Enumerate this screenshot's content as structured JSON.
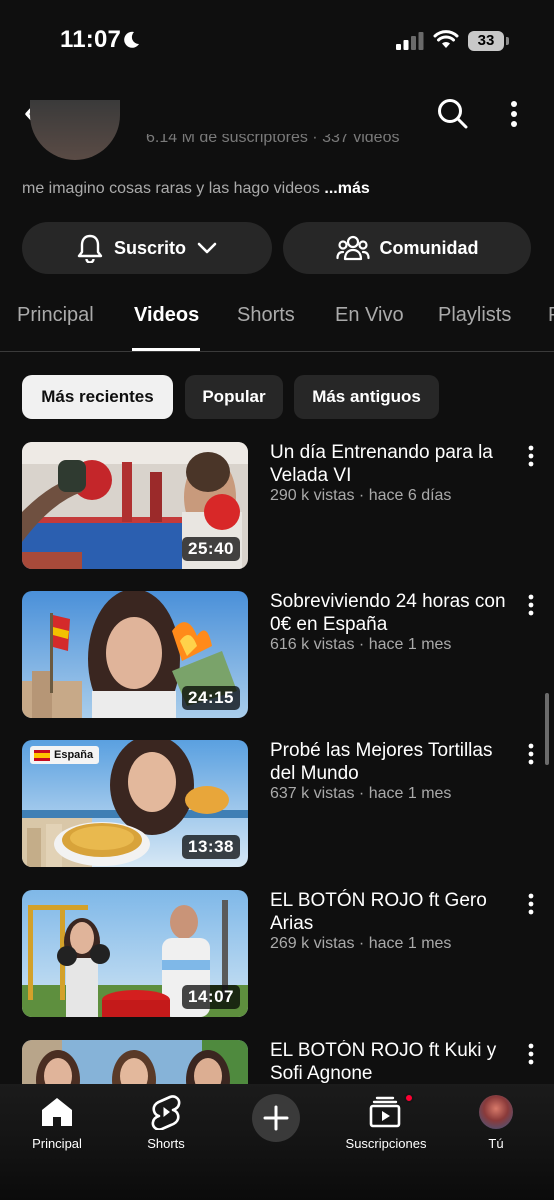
{
  "status_bar": {
    "time": "11:07",
    "battery": "33"
  },
  "header": {
    "back_icon": "chevron-left-icon",
    "search_icon": "search-icon",
    "more_icon": "more-vertical-icon"
  },
  "channel": {
    "stats": "6.14 M de suscriptores · 337 videos",
    "description": "me imagino cosas raras y las hago videos",
    "description_more": "...más",
    "subscribe_label": "Suscrito",
    "community_label": "Comunidad"
  },
  "tabs": [
    {
      "label": "Principal"
    },
    {
      "label": "Videos"
    },
    {
      "label": "Shorts"
    },
    {
      "label": "En Vivo"
    },
    {
      "label": "Playlists"
    },
    {
      "label": "P"
    }
  ],
  "active_tab": "Videos",
  "chips": [
    {
      "label": "Más recientes"
    },
    {
      "label": "Popular"
    },
    {
      "label": "Más antiguos"
    }
  ],
  "selected_chip": "Más recientes",
  "videos": [
    {
      "title": "Un día Entrenando para la Velada VI",
      "meta": "290 k vistas · hace 6 días",
      "duration": "25:40"
    },
    {
      "title": "Sobreviviendo 24 horas con 0€ en España",
      "meta": "616 k vistas · hace 1 mes",
      "duration": "24:15"
    },
    {
      "title": "Probé las Mejores Tortillas del Mundo",
      "meta": "637 k vistas · hace 1 mes",
      "duration": "13:38",
      "badge": "España"
    },
    {
      "title": "EL BOTÓN ROJO ft Gero Arias",
      "meta": "269 k vistas · hace 1 mes",
      "duration": "14:07"
    },
    {
      "title": "EL BOTÓN ROJO ft Kuki y Sofi Agnone",
      "meta": "",
      "duration": ""
    }
  ],
  "bottom_nav": [
    {
      "label": "Principal",
      "icon": "home-icon"
    },
    {
      "label": "Shorts",
      "icon": "shorts-icon"
    },
    {
      "label": "",
      "icon": "plus-icon"
    },
    {
      "label": "Suscripciones",
      "icon": "subscriptions-icon"
    },
    {
      "label": "Tú",
      "icon": "avatar"
    }
  ],
  "colors": {
    "background": "#0f0f0f",
    "surface": "#272727",
    "text_secondary": "#aaaaaa",
    "notification": "#ff0033"
  }
}
